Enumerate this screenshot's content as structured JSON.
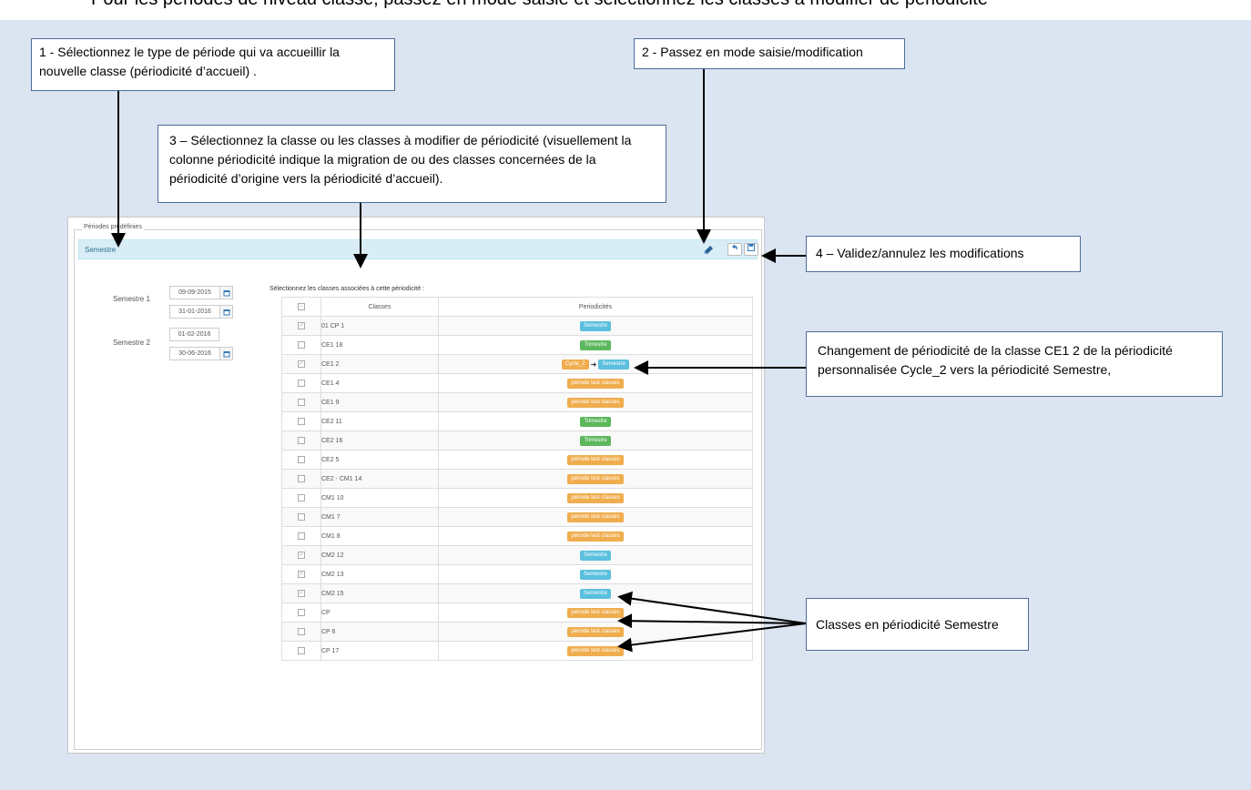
{
  "header_cut_text": "Pour les périodes de niveau classe, passez en mode saisie et sélectionnez les classes à modifier de périodicité",
  "callouts": {
    "step1": "1 - Sélectionnez le type de période qui va accueillir la nouvelle classe (périodicité d’accueil) .",
    "step2": "2 - Passez en mode saisie/modification",
    "step3": "3 – Sélectionnez la classe ou les classes à modifier de périodicité (visuellement la colonne périodicité indique la migration de ou des classes concernées de la périodicité d’origine vers la périodicité d’accueil).",
    "step4": "4 – Validez/annulez les modifications",
    "change": "Changement de périodicité de la classe CE1 2 de la périodicité personnalisée Cycle_2 vers la périodicité Semestre,",
    "semestre": "Classes en périodicité Semestre"
  },
  "app": {
    "legend": "Périodes prédéfinies",
    "panel_title": "Semestre",
    "edit_icon": "pencil-edit-icon",
    "undo_icon": "undo-icon",
    "save_icon": "save-icon",
    "periods": [
      {
        "label": "Semestre 1",
        "start": "09-09-2015",
        "end": "31-01-2016"
      },
      {
        "label": "Semestre 2",
        "start": "01-02-2016",
        "end": "30-06-2016"
      }
    ],
    "select_label": "Sélectionnez les classes associées à cette périodicité :",
    "table": {
      "col_classes": "Classes",
      "col_periodicites": "Periodicités",
      "rows": [
        {
          "checked": true,
          "name": "01 CP 1",
          "badges": [
            {
              "text": "Semestre",
              "kind": "sem"
            }
          ]
        },
        {
          "checked": false,
          "name": "CE1 18",
          "badges": [
            {
              "text": "Trimestre",
              "kind": "tri"
            }
          ]
        },
        {
          "checked": true,
          "name": "CE1 2",
          "badges": [
            {
              "text": "Cycle_2",
              "kind": "per"
            },
            {
              "text": "Semestre",
              "kind": "sem"
            }
          ]
        },
        {
          "checked": false,
          "name": "CE1 4",
          "badges": [
            {
              "text": "période test classes",
              "kind": "per"
            }
          ]
        },
        {
          "checked": false,
          "name": "CE1 9",
          "badges": [
            {
              "text": "période test classes",
              "kind": "per"
            }
          ]
        },
        {
          "checked": false,
          "name": "CE2 11",
          "badges": [
            {
              "text": "Trimestre",
              "kind": "tri"
            }
          ]
        },
        {
          "checked": false,
          "name": "CE2 16",
          "badges": [
            {
              "text": "Trimestre",
              "kind": "tri"
            }
          ]
        },
        {
          "checked": false,
          "name": "CE2 5",
          "badges": [
            {
              "text": "période test classes",
              "kind": "per"
            }
          ]
        },
        {
          "checked": false,
          "name": "CE2 - CM1 14",
          "badges": [
            {
              "text": "période test classes",
              "kind": "per"
            }
          ]
        },
        {
          "checked": false,
          "name": "CM1 10",
          "badges": [
            {
              "text": "période test classes",
              "kind": "per"
            }
          ]
        },
        {
          "checked": false,
          "name": "CM1 7",
          "badges": [
            {
              "text": "période test classes",
              "kind": "per"
            }
          ]
        },
        {
          "checked": false,
          "name": "CM1 8",
          "badges": [
            {
              "text": "période test classes",
              "kind": "per"
            }
          ]
        },
        {
          "checked": true,
          "name": "CM2 12",
          "badges": [
            {
              "text": "Semestre",
              "kind": "sem"
            }
          ]
        },
        {
          "checked": true,
          "name": "CM2 13",
          "badges": [
            {
              "text": "Semestre",
              "kind": "sem"
            }
          ]
        },
        {
          "checked": true,
          "name": "CM2 15",
          "badges": [
            {
              "text": "Semestre",
              "kind": "sem"
            }
          ]
        },
        {
          "checked": false,
          "name": "CP",
          "badges": [
            {
              "text": "période test classes",
              "kind": "per"
            }
          ]
        },
        {
          "checked": false,
          "name": "CP 6",
          "badges": [
            {
              "text": "période test classes",
              "kind": "per"
            }
          ]
        },
        {
          "checked": false,
          "name": "CP 17",
          "badges": [
            {
              "text": "période test classes",
              "kind": "per"
            }
          ]
        }
      ]
    }
  },
  "colors": {
    "background": "#dbe5f1",
    "callout_border": "#4a6c9b",
    "panel_head": "#d9edf7",
    "semestre": "#5bc0de",
    "trimestre": "#5cb85c",
    "periode": "#f0ad4e"
  }
}
